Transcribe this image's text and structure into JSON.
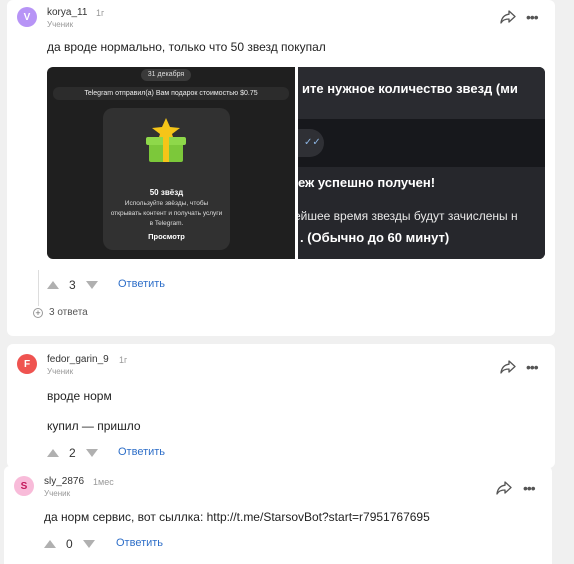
{
  "comments": [
    {
      "avatar_letter": "V",
      "avatar_color": "#b794f6",
      "username": "korya_11",
      "time": "1г",
      "role": "Ученик",
      "text": "да вроде нормально, только что 50 звезд покупал",
      "votes": "3",
      "reply_label": "Ответить",
      "replies_toggle": "3 ответа",
      "attachment_left": {
        "date_pill": "31 декабря",
        "telegram_line": "Telegram отправил(а) Вам подарок стоимостью $0.75",
        "gift_title": "50 звёзд",
        "gift_desc": "Используйте звёзды, чтобы открывать контент и получать услуги в Telegram.",
        "gift_button": "Просмотр"
      },
      "attachment_right": {
        "line1": "ите нужное количество звезд (ми",
        "check": "✓✓",
        "line2": "еж успешно получен!",
        "line3": "ейшее время звезды будут зачислены н",
        "line4": ". (Обычно до 60 минут)"
      }
    },
    {
      "avatar_letter": "F",
      "avatar_color": "#ef5350",
      "username": "fedor_garin_9",
      "time": "1г",
      "role": "Ученик",
      "text_line1": "вроде норм",
      "text_line2": "купил — пришло",
      "votes": "2",
      "reply_label": "Ответить"
    },
    {
      "avatar_letter": "S",
      "avatar_color": "#f8bbd9",
      "avatar_text_color": "#c2185b",
      "username": "sly_2876",
      "time": "1мес",
      "role": "Ученик",
      "text": "да норм сервис, вот сыллка: http://t.me/StarsovBot?start=r7951767695",
      "votes": "0",
      "reply_label": "Ответить"
    }
  ],
  "icons": {
    "share": "share-arrow-icon",
    "more": "more-horizontal-icon",
    "upvote": "upvote-triangle-icon",
    "downvote": "downvote-triangle-icon"
  }
}
